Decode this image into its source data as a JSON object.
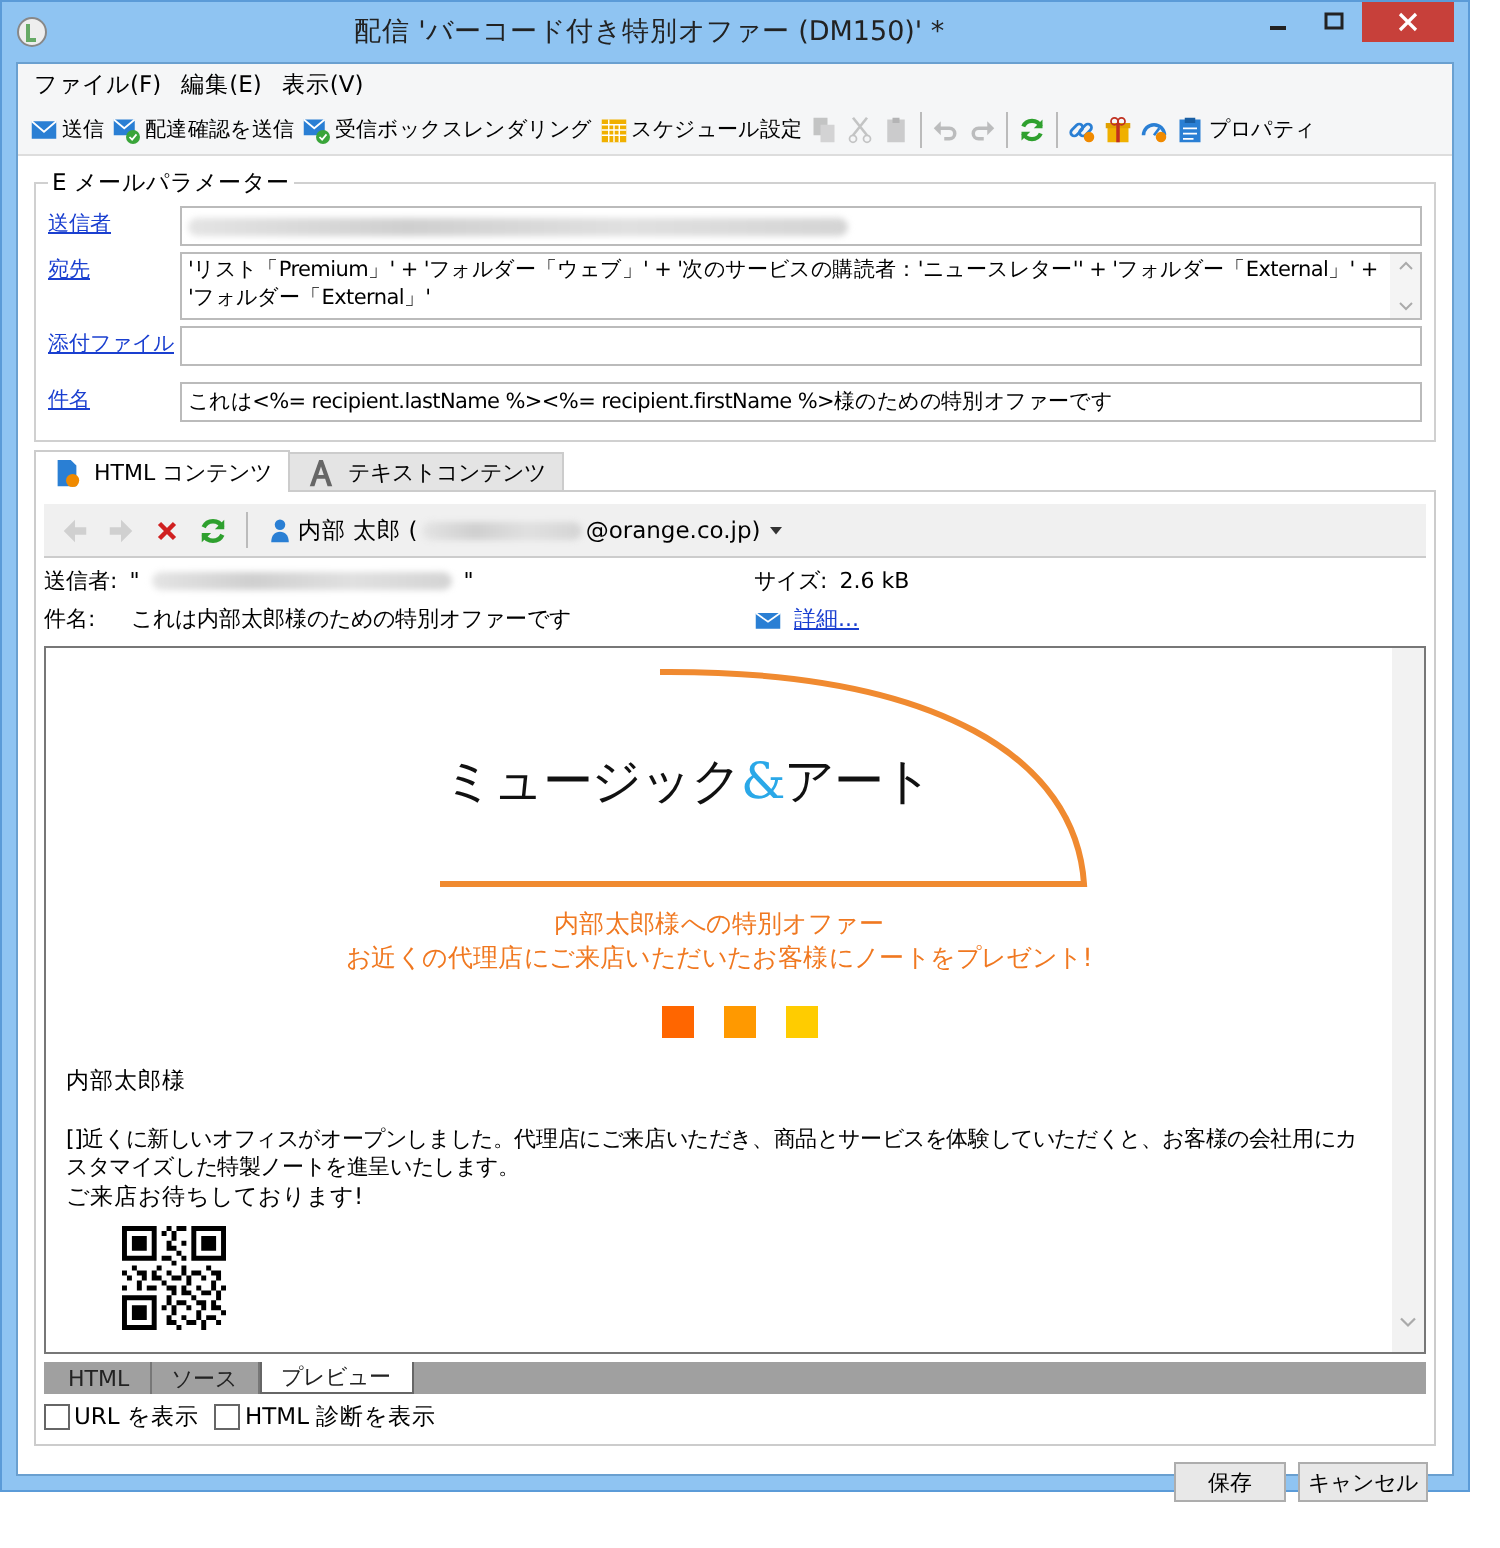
{
  "window": {
    "title": "配信 'バーコード付き特別オファー (DM150)' *"
  },
  "menu": [
    {
      "label": "ファイル(F)"
    },
    {
      "label": "編集(E)"
    },
    {
      "label": "表示(V)"
    }
  ],
  "toolbar": [
    {
      "kind": "button",
      "label": "送信",
      "disabled": false
    },
    {
      "kind": "button",
      "label": "配達確認を送信",
      "disabled": false
    },
    {
      "kind": "button",
      "label": "受信ボックスレンダリング",
      "disabled": false
    },
    {
      "kind": "button",
      "label": "スケジュール設定",
      "disabled": false
    },
    {
      "kind": "button",
      "disabled": true
    },
    {
      "kind": "button",
      "disabled": true
    },
    {
      "kind": "button",
      "disabled": true
    },
    {
      "kind": "separator"
    },
    {
      "kind": "button",
      "disabled": true
    },
    {
      "kind": "button",
      "disabled": true
    },
    {
      "kind": "separator"
    },
    {
      "kind": "button",
      "disabled": false
    },
    {
      "kind": "separator"
    },
    {
      "kind": "button",
      "disabled": false
    },
    {
      "kind": "button",
      "disabled": false
    },
    {
      "kind": "button",
      "disabled": false
    },
    {
      "kind": "button",
      "label": "プロパティ",
      "disabled": false
    }
  ],
  "email_parameters": {
    "legend": "E メールパラメーター",
    "fields": [
      {
        "kind": "single",
        "label": "送信者",
        "redacted": true
      },
      {
        "kind": "multi",
        "label": "宛先",
        "value": "'リスト「Premium」' + 'フォルダー「ウェブ」' + '次のサービスの購読者：'ニュースレター'' + 'フォルダー「External」' + 'フォルダー「External」'",
        "redacted": false
      },
      {
        "kind": "single",
        "label": "添付ファイル",
        "redacted": false
      },
      {
        "kind": "single",
        "label": "件名",
        "value": "これは<%= recipient.lastName %><%= recipient.firstName %>様のための特別オファーです",
        "redacted": false
      }
    ]
  },
  "content_tabs": [
    {
      "label": "HTML コンテンツ",
      "selected": true
    },
    {
      "label": "テキストコンテンツ",
      "selected": false
    }
  ],
  "preview_toolbar": {
    "buttons": [
      {
        "disabled": true
      },
      {
        "disabled": true
      },
      {
        "disabled": false
      },
      {
        "disabled": false
      }
    ],
    "recipient": {
      "name": "内部 太郎 (",
      "domain": "@orange.co.jp)"
    }
  },
  "headers": {
    "sender_label": "送信者:",
    "open_quote": "\"",
    "close_quote": "\"",
    "size_label": "サイズ:",
    "size": "2.6 kB",
    "subject_label": "件名:",
    "subject": "これは内部太郎様のための特別オファーです",
    "details_link": "詳細..."
  },
  "email_body": {
    "logo": {
      "before": "ミュージック",
      "amp": "&",
      "after": "アート"
    },
    "headline": [
      "内部太郎様への特別オファー",
      "お近くの代理店にご来店いただいたお客様にノートをプレゼント!"
    ],
    "squares": [
      {
        "color": "#ff6600"
      },
      {
        "color": "#ff9900"
      },
      {
        "color": "#ffcc00"
      }
    ],
    "greeting": "内部太郎様",
    "paragraph": "[]近くに新しいオフィスがオープンしました。代理店にご来店いただき、商品とサービスを体験していただくと、お客様の会社用にカスタマイズした特製ノートを進呈いたします。",
    "closing": "ご来店お待ちしております!"
  },
  "view_tabs": [
    {
      "label": "HTML",
      "selected": false
    },
    {
      "label": "ソース",
      "selected": false
    },
    {
      "label": "プレビュー",
      "selected": true
    }
  ],
  "options": [
    {
      "label": "URL を表示",
      "checked": false
    },
    {
      "label": "HTML 診断を表示",
      "checked": false
    }
  ],
  "buttons": [
    {
      "label": "保存"
    },
    {
      "label": "キャンセル"
    }
  ]
}
